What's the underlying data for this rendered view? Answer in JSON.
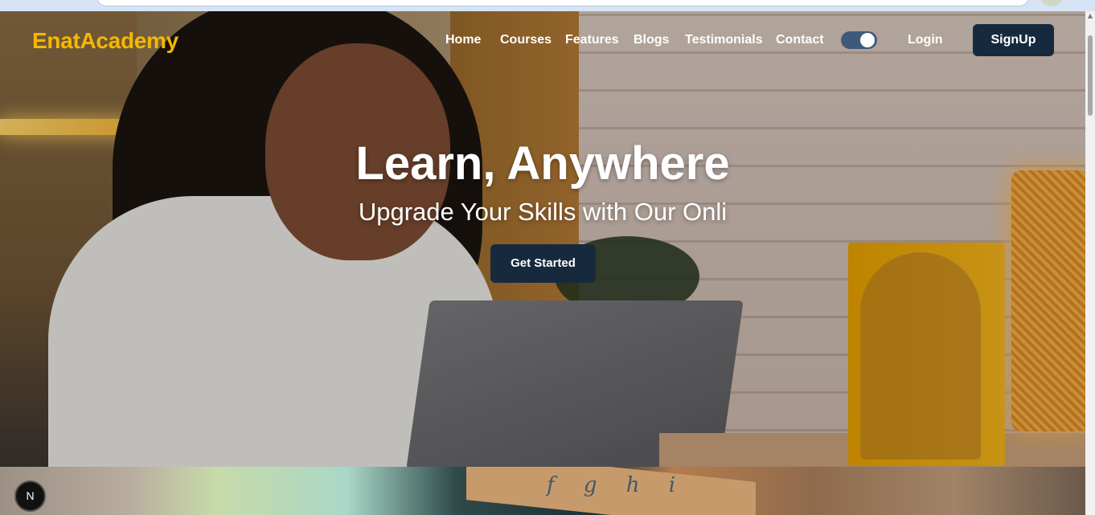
{
  "nav": {
    "logo": "EnatAcademy",
    "links": [
      "Home",
      "Courses",
      "Features",
      "Blogs",
      "Testimonials",
      "Contact"
    ],
    "login": "Login",
    "signup": "SignUp",
    "theme_toggle_on": true
  },
  "hero": {
    "title": "Learn, Anywhere",
    "subtitle": "Upgrade Your Skills with Our Onli",
    "cta": "Get Started"
  },
  "section2": {
    "ruler_text": "f g h i"
  },
  "dev_badge": "N",
  "colors": {
    "logo": "#f5b800",
    "primary_button": "#172a3d",
    "toggle": "#3f5a78"
  },
  "icons": {
    "dev_badge": "nextjs-icon",
    "toggle": "theme-toggle-icon"
  }
}
